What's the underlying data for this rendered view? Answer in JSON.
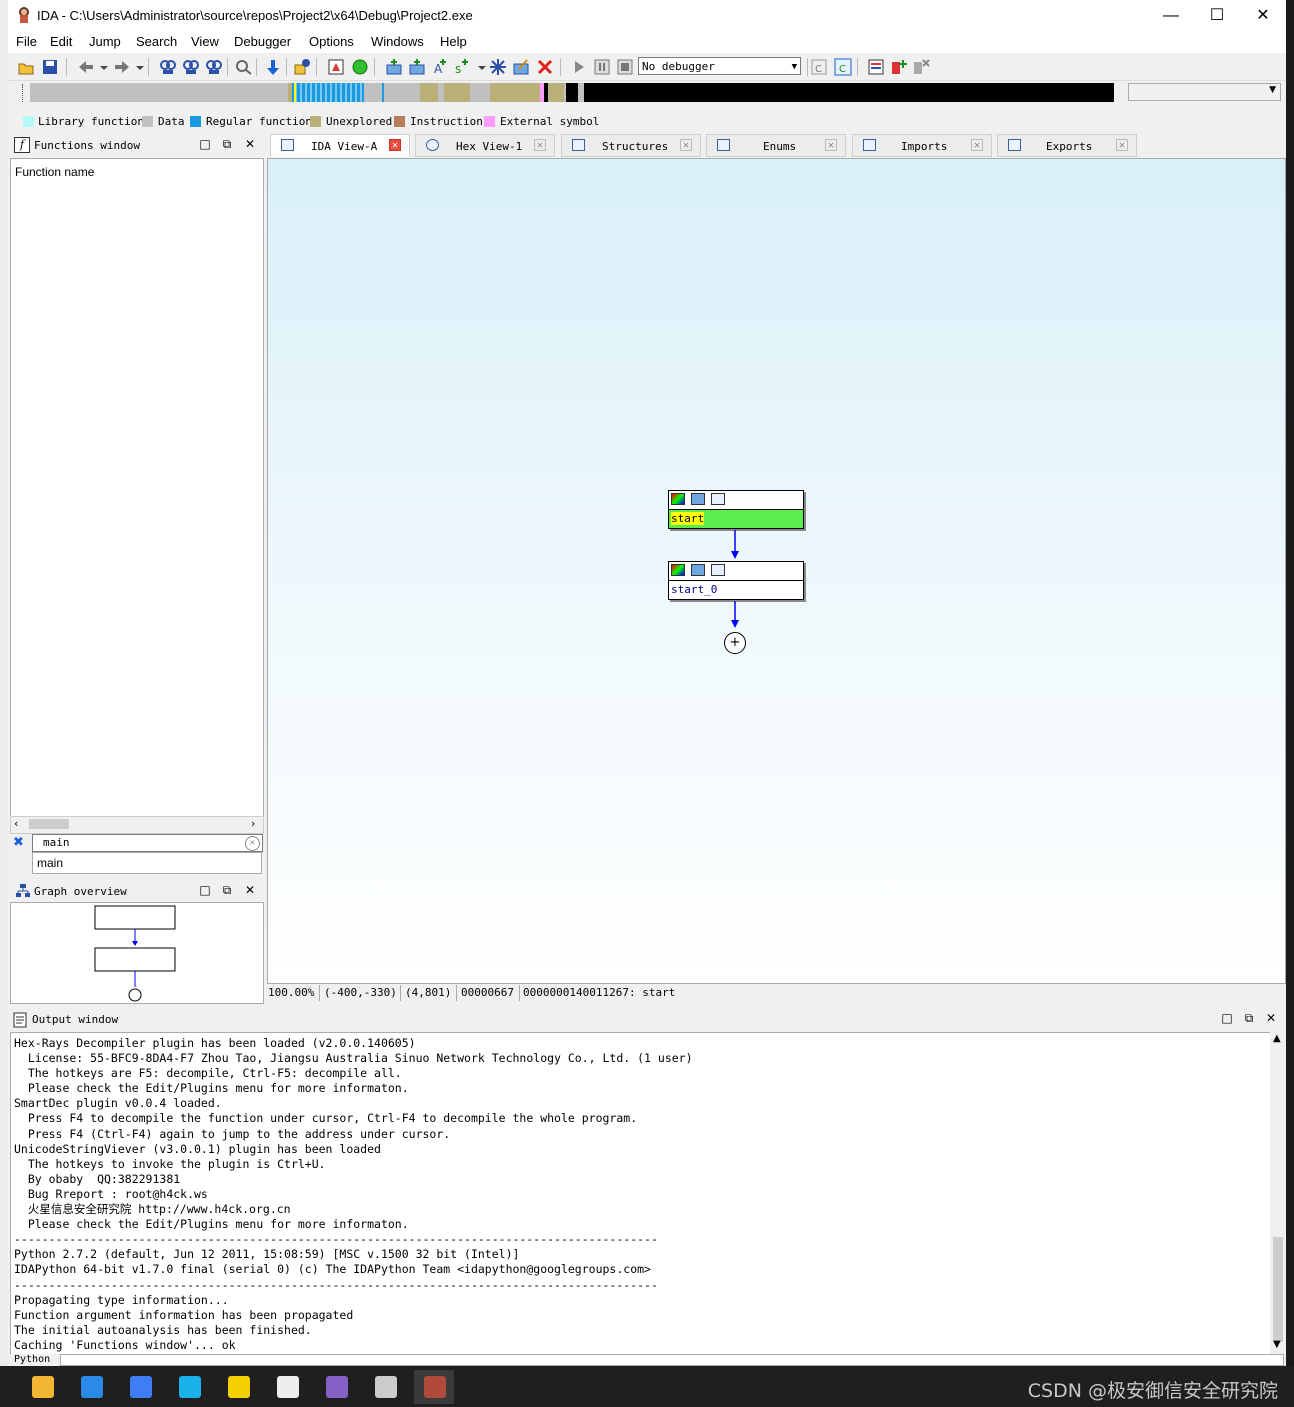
{
  "window": {
    "title": "IDA - C:\\Users\\Administrator\\source\\repos\\Project2\\x64\\Debug\\Project2.exe",
    "minimize": "—",
    "maximize": "☐",
    "close": "✕"
  },
  "menu": [
    "File",
    "Edit",
    "Jump",
    "Search",
    "View",
    "Debugger",
    "Options",
    "Windows",
    "Help"
  ],
  "toolbar": {
    "debugger_select": "No debugger"
  },
  "legend": [
    {
      "label": "Library function",
      "color": "#b6f7f7"
    },
    {
      "label": "Data",
      "color": "#c0c0c0"
    },
    {
      "label": "Regular function",
      "color": "#1a9ae0"
    },
    {
      "label": "Unexplored",
      "color": "#b8b078"
    },
    {
      "label": "Instruction",
      "color": "#b87d5c"
    },
    {
      "label": "External symbol",
      "color": "#ff9cff"
    }
  ],
  "functions_window": {
    "title": "Functions window",
    "column": "Function name",
    "filter": "main",
    "suggestion": "main"
  },
  "graph_overview": {
    "title": "Graph overview"
  },
  "tabs": [
    {
      "label": "IDA View-A",
      "active": true
    },
    {
      "label": "Hex View-1",
      "active": false
    },
    {
      "label": "Structures",
      "active": false
    },
    {
      "label": "Enums",
      "active": false
    },
    {
      "label": "Imports",
      "active": false
    },
    {
      "label": "Exports",
      "active": false
    }
  ],
  "graph": {
    "nodes": [
      {
        "label": "start",
        "highlight_color": "#59ee4c",
        "selected_text_color": "#ffff00"
      },
      {
        "label": "start_0"
      }
    ],
    "end_marker": "+"
  },
  "status": {
    "zoom": "100.00%",
    "coords": "(-400,-330)",
    "mouse": "(4,801)",
    "offset": "00000667",
    "address": "0000000140011267: start"
  },
  "output_window": {
    "title": "Output window",
    "lines": [
      "Hex-Rays Decompiler plugin has been loaded (v2.0.0.140605)",
      "  License: 55-BFC9-8DA4-F7 Zhou Tao, Jiangsu Australia Sinuo Network Technology Co., Ltd. (1 user)",
      "  The hotkeys are F5: decompile, Ctrl-F5: decompile all.",
      "  Please check the Edit/Plugins menu for more informaton.",
      "SmartDec plugin v0.0.4 loaded.",
      "  Press F4 to decompile the function under cursor, Ctrl-F4 to decompile the whole program.",
      "  Press F4 (Ctrl-F4) again to jump to the address under cursor.",
      "UnicodeStringViever (v3.0.0.1) plugin has been loaded",
      "  The hotkeys to invoke the plugin is Ctrl+U.",
      "  By obaby  QQ:382291381",
      "  Bug Rreport : root@h4ck.ws",
      "  火星信息安全研究院 http://www.h4ck.org.cn",
      "  Please check the Edit/Plugins menu for more informaton.",
      "---------------------------------------------------------------------------------------------",
      "Python 2.7.2 (default, Jun 12 2011, 15:08:59) [MSC v.1500 32 bit (Intel)]",
      "IDAPython 64-bit v1.7.0 final (serial 0) (c) The IDAPython Team <idapython@googlegroups.com>",
      "---------------------------------------------------------------------------------------------",
      "Propagating type information...",
      "Function argument information has been propagated",
      "The initial autoanalysis has been finished.",
      "Caching 'Functions window'... ok"
    ],
    "cmd_label": "Python"
  },
  "taskbar": {
    "apps": [
      {
        "name": "file-explorer",
        "color": "#f2b632"
      },
      {
        "name": "mail",
        "color": "#2b8ae5"
      },
      {
        "name": "feishu",
        "color": "#3f7df6"
      },
      {
        "name": "translator",
        "color": "#1ab0e8"
      },
      {
        "name": "browser",
        "color": "#f5d000"
      },
      {
        "name": "typora",
        "color": "#eeeeee"
      },
      {
        "name": "visual-studio",
        "color": "#8661c5"
      },
      {
        "name": "task-manager",
        "color": "#cccccc"
      },
      {
        "name": "ida",
        "color": "#b04a3a"
      }
    ],
    "watermark": "CSDN @极安御信安全研究院"
  }
}
